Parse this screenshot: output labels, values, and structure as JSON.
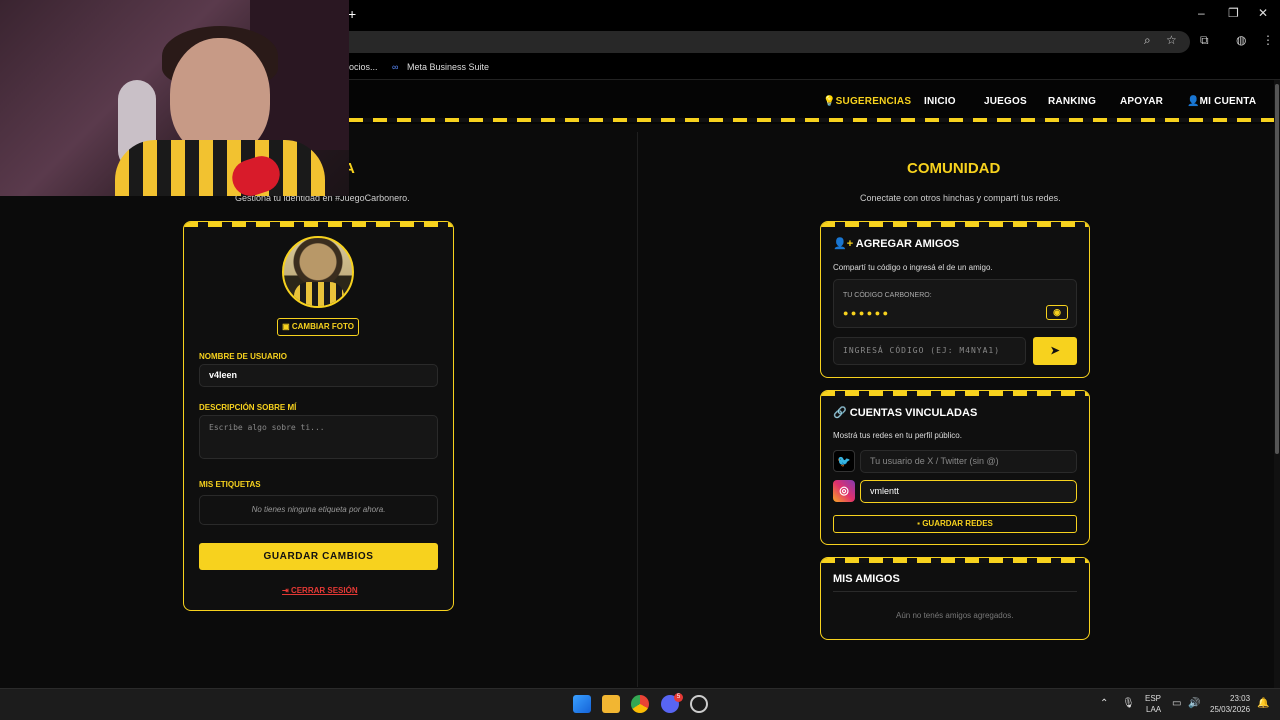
{
  "browser": {
    "new_tab": "+",
    "bookmarks": [
      "ocios...",
      "Meta Business Suite"
    ],
    "window_controls": [
      "–",
      "❐",
      "✕"
    ]
  },
  "nav": {
    "items": [
      {
        "label": "SUGERENCIAS",
        "icon": "💡"
      },
      {
        "label": "INICIO"
      },
      {
        "label": "JUEGOS"
      },
      {
        "label": "RANKING"
      },
      {
        "label": "APOYAR"
      },
      {
        "label": "MI CUENTA",
        "icon": "👤"
      }
    ]
  },
  "profile": {
    "title_partial": "TA",
    "subtitle": "Gestiona tu identidad en #JuegoCarbonero.",
    "change_photo": "CAMBIAR FOTO",
    "username_label": "NOMBRE DE USUARIO",
    "username_value": "v4leen",
    "description_label": "DESCRIPCIÓN SOBRE MÍ",
    "description_placeholder": "Escribe algo sobre ti...",
    "tags_label": "MIS ETIQUETAS",
    "tags_empty": "No tienes ninguna etiqueta por ahora.",
    "save_button": "GUARDAR CAMBIOS",
    "logout": "CERRAR SESIÓN"
  },
  "community": {
    "title": "COMUNIDAD",
    "subtitle": "Conectate con otros hinchas y compartí tus redes.",
    "add_friends": {
      "title": "AGREGAR AMIGOS",
      "description": "Compartí tu código o ingresá el de un amigo.",
      "code_label": "TU CÓDIGO CARBONERO:",
      "code_masked": "● ● ● ● ● ●",
      "input_placeholder": "INGRESÁ CÓDIGO (EJ: M4NYA1)"
    },
    "linked": {
      "title": "CUENTAS VINCULADAS",
      "description": "Mostrá tus redes en tu perfil público.",
      "twitter_placeholder": "Tu usuario de X / Twitter (sin @)",
      "instagram_value": "vmlentt",
      "save_button": "GUARDAR REDES"
    },
    "friends": {
      "title": "MIS AMIGOS",
      "empty": "Aún no tenés amigos agregados."
    }
  },
  "taskbar": {
    "lang": "ESP",
    "layout": "LAA",
    "time": "23:03",
    "date": "25/03/2026",
    "discord_badge": "5"
  },
  "colors": {
    "accent": "#f7d21e",
    "background": "#0b0b0b",
    "danger": "#e53935"
  }
}
